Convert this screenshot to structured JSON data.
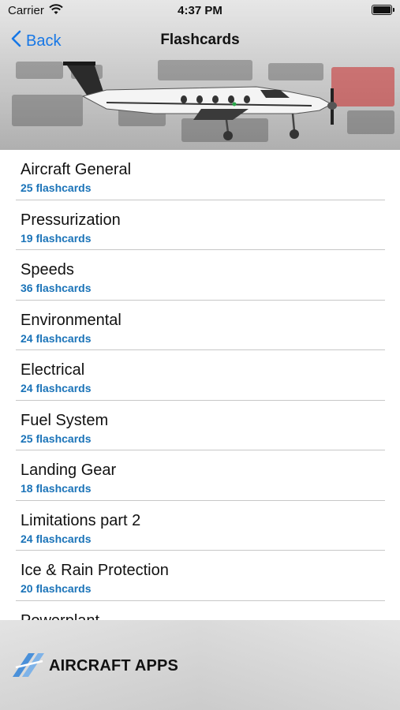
{
  "status": {
    "carrier": "Carrier",
    "time": "4:37 PM"
  },
  "nav": {
    "back_label": "Back",
    "title": "Flashcards"
  },
  "items": [
    {
      "title": "Aircraft General",
      "count": "25 flashcards"
    },
    {
      "title": "Pressurization",
      "count": "19 flashcards"
    },
    {
      "title": "Speeds",
      "count": "36 flashcards"
    },
    {
      "title": "Environmental",
      "count": "24 flashcards"
    },
    {
      "title": "Electrical",
      "count": "24 flashcards"
    },
    {
      "title": "Fuel System",
      "count": "25 flashcards"
    },
    {
      "title": "Landing Gear",
      "count": "18 flashcards"
    },
    {
      "title": "Limitations part 2",
      "count": "24 flashcards"
    },
    {
      "title": "Ice & Rain Protection",
      "count": "20 flashcards"
    },
    {
      "title": "Powerplant",
      "count": ""
    }
  ],
  "footer": {
    "brand": "AIRCRAFT APPS"
  },
  "colors": {
    "accent": "#1677e6",
    "subtitle": "#1a73b8",
    "separator": "#c7c7c7"
  }
}
